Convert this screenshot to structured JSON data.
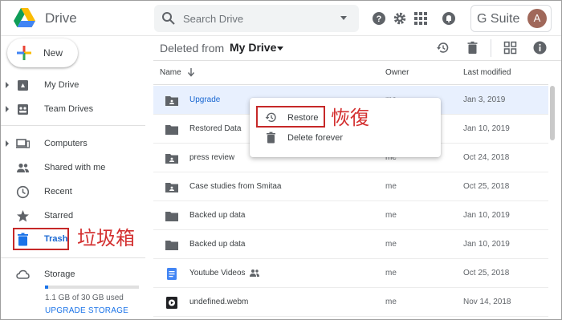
{
  "header": {
    "app_title": "Drive",
    "search_placeholder": "Search Drive",
    "gsuite_label": "G Suite",
    "avatar_letter": "A"
  },
  "sidebar": {
    "new_label": "New",
    "items": [
      {
        "label": "My Drive",
        "icon": "my-drive-icon"
      },
      {
        "label": "Team Drives",
        "icon": "team-drives-icon"
      },
      {
        "label": "Computers",
        "icon": "computers-icon"
      },
      {
        "label": "Shared with me",
        "icon": "shared-with-me-icon"
      },
      {
        "label": "Recent",
        "icon": "recent-clock-icon"
      },
      {
        "label": "Starred",
        "icon": "star-icon"
      },
      {
        "label": "Trash",
        "icon": "trash-icon"
      }
    ],
    "storage_label": "Storage",
    "storage_used_text": "1.1 GB of 30 GB used",
    "storage_fraction": 0.037,
    "upgrade_label": "UPGRADE STORAGE"
  },
  "annotations": {
    "trash_callout": "垃圾箱",
    "restore_callout": "恢復"
  },
  "toolbar": {
    "crumb_prefix": "Deleted from",
    "crumb_current": "My Drive"
  },
  "columns": {
    "name": "Name",
    "owner": "Owner",
    "last_modified": "Last modified"
  },
  "files": [
    {
      "name": "Upgrade",
      "owner": "me",
      "modified": "Jan 3, 2019",
      "icon": "shared-folder-icon"
    },
    {
      "name": "Restored Data",
      "owner": "me",
      "modified": "Jan 10, 2019",
      "icon": "folder-icon"
    },
    {
      "name": "press review",
      "owner": "me",
      "modified": "Oct 24, 2018",
      "icon": "shared-folder-icon"
    },
    {
      "name": "Case studies from Smitaa",
      "owner": "me",
      "modified": "Oct 25, 2018",
      "icon": "shared-folder-icon"
    },
    {
      "name": "Backed up data",
      "owner": "me",
      "modified": "Jan 10, 2019",
      "icon": "folder-icon"
    },
    {
      "name": "Backed up data",
      "owner": "me",
      "modified": "Jan 10, 2019",
      "icon": "folder-icon"
    },
    {
      "name": "Youtube Videos",
      "owner": "me",
      "modified": "Oct 25, 2018",
      "icon": "google-doc-icon"
    },
    {
      "name": "undefined.webm",
      "owner": "me",
      "modified": "Nov 14, 2018",
      "icon": "video-file-icon"
    }
  ],
  "context_menu": {
    "restore_label": "Restore",
    "delete_label": "Delete forever"
  },
  "colors": {
    "accent": "#1a73e8",
    "selected_row": "#e8f0fe",
    "annotation_red": "#d32f2f"
  }
}
